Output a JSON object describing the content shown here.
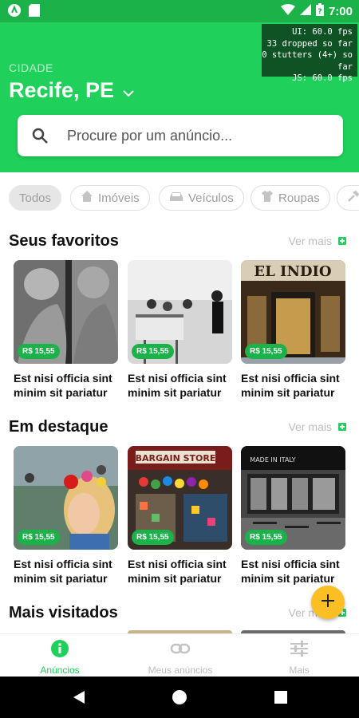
{
  "status_bar": {
    "time": "7:00"
  },
  "perf_monitor": {
    "ui": "UI: 60.0 fps",
    "dropped": "33 dropped so far",
    "stutters": "0 stutters (4+) so far",
    "js": "JS: 60.0 fps"
  },
  "header": {
    "city_label": "CIDADE",
    "city": "Recife, PE"
  },
  "search": {
    "placeholder": "Procure por um anúncio..."
  },
  "categories": [
    {
      "label": "Todos",
      "icon": "none",
      "active": true
    },
    {
      "label": "Imóveis",
      "icon": "home-icon",
      "active": false
    },
    {
      "label": "Veículos",
      "icon": "car-icon",
      "active": false
    },
    {
      "label": "Roupas",
      "icon": "shirt-icon",
      "active": false
    }
  ],
  "sections": [
    {
      "title": "Seus favoritos",
      "see_more": "Ver mais",
      "items": [
        {
          "price": "R$ 15,55",
          "title": "Est nisi officia sint minim sit pariatur"
        },
        {
          "price": "R$ 15,55",
          "title": "Est nisi officia sint minim sit pariatur"
        },
        {
          "price": "R$ 15,55",
          "title": "Est nisi officia sint minim sit pariatur"
        }
      ]
    },
    {
      "title": "Em destaque",
      "see_more": "Ver mais",
      "items": [
        {
          "price": "R$ 15,55",
          "title": "Est nisi officia sint minim sit pariatur"
        },
        {
          "price": "R$ 15,55",
          "title": "Est nisi officia sint minim sit pariatur"
        },
        {
          "price": "R$ 15,55",
          "title": "Est nisi officia sint minim sit pariatur"
        }
      ]
    },
    {
      "title": "Mais visitados",
      "see_more": "Ver mais"
    }
  ],
  "bottom_nav": [
    {
      "label": "Anúncios",
      "icon": "info-icon",
      "active": true
    },
    {
      "label": "Meus anúncios",
      "icon": "link-icon",
      "active": false
    },
    {
      "label": "Mais",
      "icon": "sliders-icon",
      "active": false
    }
  ],
  "colors": {
    "primary": "#1fd05b",
    "price_badge": "#1cb24a",
    "fab": "#fbbf24"
  }
}
